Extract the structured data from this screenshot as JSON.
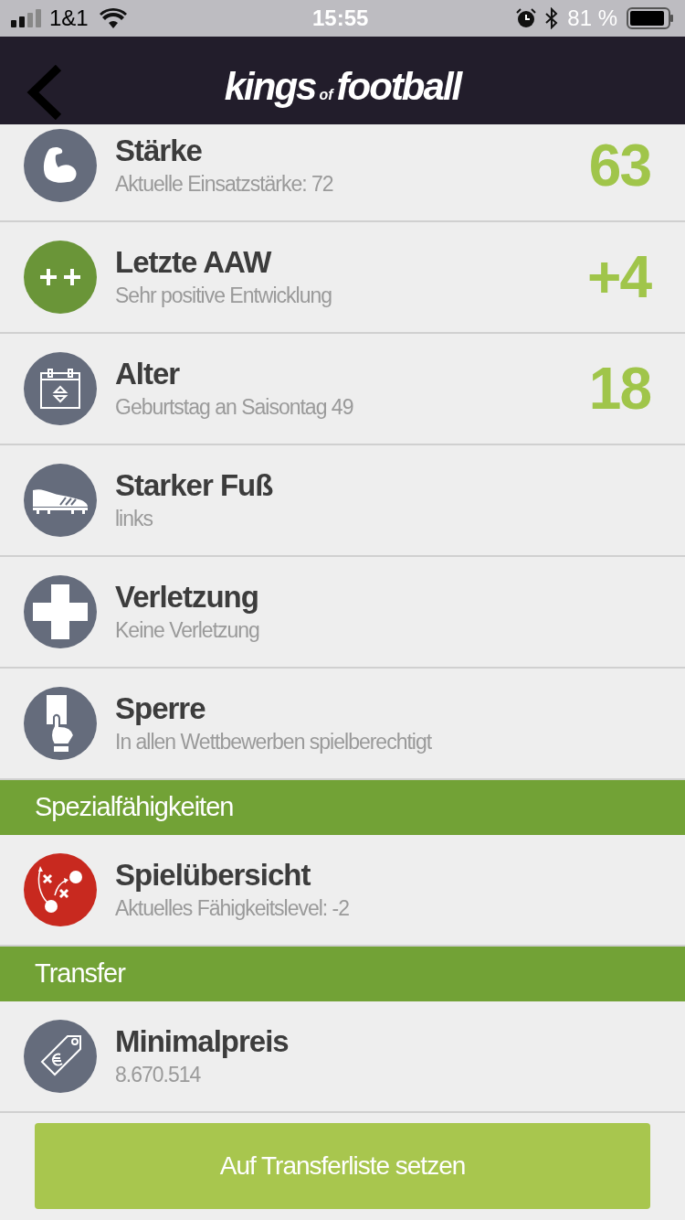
{
  "status_bar": {
    "carrier": "1&1",
    "time": "15:55",
    "battery": "81 %"
  },
  "header": {
    "logo": [
      "kings",
      "of",
      "football"
    ]
  },
  "sections": [
    {
      "rows": [
        {
          "kind": "muscle",
          "color": "#656c7c",
          "title": "Stärke",
          "subtitle": "Aktuelle Einsatzstärke: 72",
          "value": "63"
        },
        {
          "kind": "plusplus",
          "color": "#6a9538",
          "title": "Letzte AAW",
          "subtitle": "Sehr positive Entwicklung",
          "value": "+4"
        },
        {
          "kind": "calendar",
          "color": "#656c7c",
          "title": "Alter",
          "subtitle": "Geburtstag an Saisontag 49",
          "value": "18"
        },
        {
          "kind": "boot",
          "color": "#656c7c",
          "title": "Starker Fuß",
          "subtitle": "links"
        },
        {
          "kind": "cross",
          "color": "#656c7c",
          "title": "Verletzung",
          "subtitle": "Keine Verletzung"
        },
        {
          "kind": "card",
          "color": "#656c7c",
          "title": "Sperre",
          "subtitle": "In allen Wettbewerben spielberechtigt"
        }
      ]
    },
    {
      "heading": "Spezialfähigkeiten",
      "rows": [
        {
          "kind": "tactics",
          "color": "#c8291f",
          "title": "Spielübersicht",
          "subtitle": "Aktuelles Fähigkeitslevel: -2"
        }
      ]
    },
    {
      "heading": "Transfer",
      "rows": [
        {
          "kind": "tag",
          "color": "#656c7c",
          "title": "Minimalpreis",
          "subtitle": "8.670.514"
        }
      ]
    }
  ],
  "button": "Auf Transferliste setzen"
}
